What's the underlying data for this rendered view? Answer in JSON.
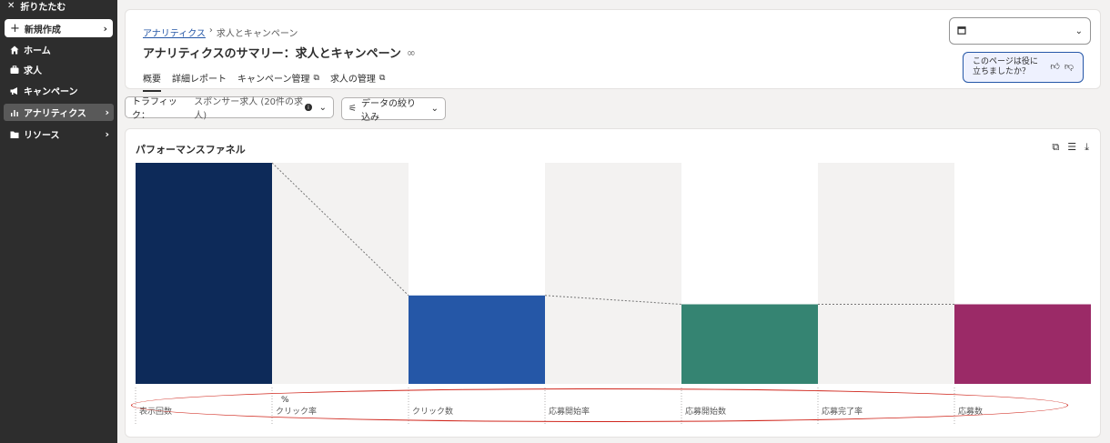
{
  "sidebar": {
    "collapse_label": "折りたたむ",
    "create_label": "新規作成",
    "items": [
      {
        "label": "ホーム",
        "icon": "home-icon"
      },
      {
        "label": "求人",
        "icon": "briefcase-icon"
      },
      {
        "label": "キャンペーン",
        "icon": "megaphone-icon"
      },
      {
        "label": "アナリティクス",
        "icon": "chart-icon"
      },
      {
        "label": "リソース",
        "icon": "folder-icon"
      }
    ]
  },
  "header": {
    "breadcrumb_link": "アナリティクス",
    "breadcrumb_sep": "›",
    "breadcrumb_current": "求人とキャンペーン",
    "title": "アナリティクスのサマリー：求人とキャンペーン",
    "tabs": [
      {
        "label": "概要"
      },
      {
        "label": "詳細レポート"
      },
      {
        "label": "キャンペーン管理"
      },
      {
        "label": "求人の管理"
      }
    ],
    "feedback_line1": "このページは役に",
    "feedback_line2": "立ちましたか？"
  },
  "filters": {
    "traffic_label": "トラフィック：",
    "traffic_value": "スポンサー求人 (20件の求人)",
    "data_filter_label": "データの絞り込み"
  },
  "funnel": {
    "title": "パフォーマンスファネル",
    "labels": [
      "表示回数",
      "クリック率",
      "クリック数",
      "応募開始率",
      "応募開始数",
      "応募完了率",
      "応募数"
    ],
    "percent_symbol": "%"
  },
  "chart_data": {
    "type": "bar",
    "categories": [
      "表示回数",
      "クリック数",
      "応募開始数",
      "応募数"
    ],
    "values": [
      100,
      40,
      36,
      36
    ],
    "ylim": [
      0,
      100
    ],
    "colors": [
      "#0d2a59",
      "#2557a7",
      "#358472",
      "#9b2a67"
    ]
  }
}
